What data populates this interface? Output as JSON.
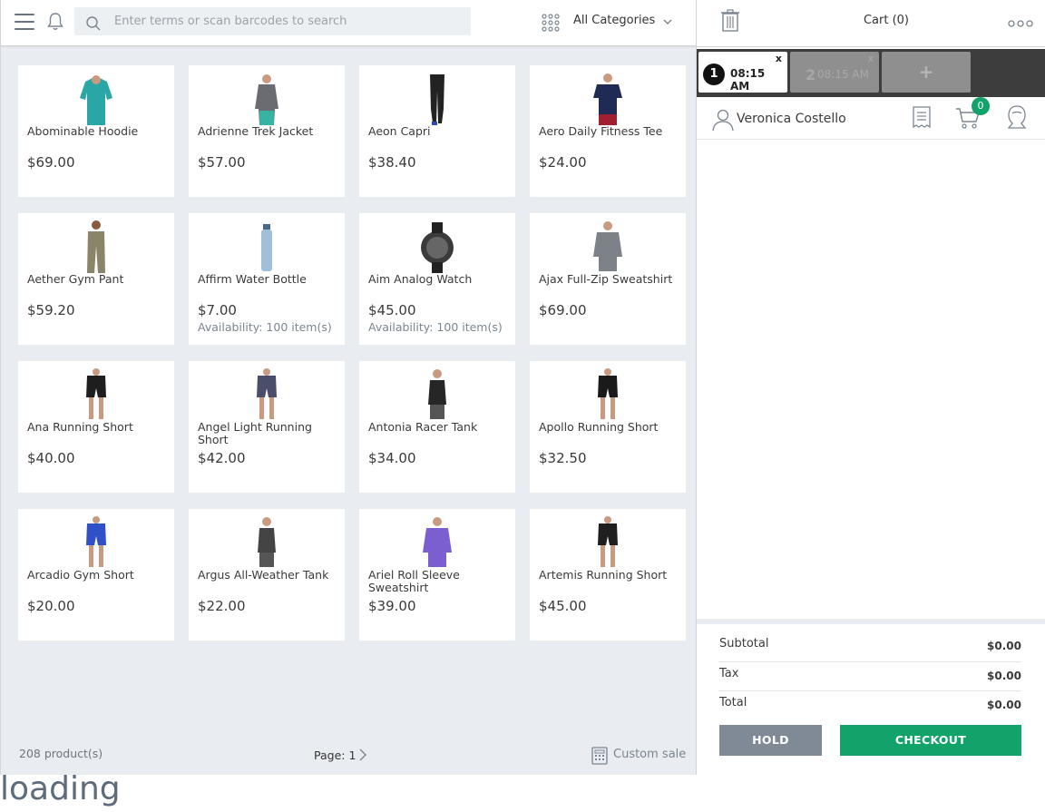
{
  "header": {
    "search_placeholder": "Enter terms or scan barcodes to search",
    "category": "All Categories"
  },
  "products": [
    {
      "name": "Abominable Hoodie",
      "price": "$69.00",
      "availability": "",
      "icon": "hoodie-thumbnail",
      "color": "#2aa6a6"
    },
    {
      "name": "Adrienne Trek Jacket",
      "price": "$57.00",
      "availability": "",
      "icon": "jacket-thumbnail",
      "color": "#6b6b72"
    },
    {
      "name": "Aeon Capri",
      "price": "$38.40",
      "availability": "",
      "icon": "capri-thumbnail",
      "color": "#222222"
    },
    {
      "name": "Aero Daily Fitness Tee",
      "price": "$24.00",
      "availability": "",
      "icon": "tee-thumbnail",
      "color": "#1f2a55"
    },
    {
      "name": "Aether Gym Pant",
      "price": "$59.20",
      "availability": "",
      "icon": "pant-thumbnail",
      "color": "#8a8468"
    },
    {
      "name": "Affirm Water Bottle",
      "price": "$7.00",
      "availability": "Availability: 100 item(s)",
      "icon": "bottle-thumbnail",
      "color": "#9fc0d8"
    },
    {
      "name": "Aim Analog Watch",
      "price": "$45.00",
      "availability": "Availability: 100 item(s)",
      "icon": "watch-thumbnail",
      "color": "#3b3b3b"
    },
    {
      "name": "Ajax Full-Zip Sweatshirt",
      "price": "$69.00",
      "availability": "",
      "icon": "sweatshirt-thumbnail",
      "color": "#7d8288"
    },
    {
      "name": "Ana Running Short",
      "price": "$40.00",
      "availability": "",
      "icon": "short-thumbnail",
      "color": "#1e1e1e"
    },
    {
      "name": "Angel Light Running Short",
      "price": "$42.00",
      "availability": "",
      "icon": "short-thumbnail",
      "color": "#4a4e6a"
    },
    {
      "name": "Antonia Racer Tank",
      "price": "$34.00",
      "availability": "",
      "icon": "tank-thumbnail",
      "color": "#262626"
    },
    {
      "name": "Apollo Running Short",
      "price": "$32.50",
      "availability": "",
      "icon": "short-thumbnail",
      "color": "#1a1a1a"
    },
    {
      "name": "Arcadio Gym Short",
      "price": "$20.00",
      "availability": "",
      "icon": "short-thumbnail",
      "color": "#3050c8"
    },
    {
      "name": "Argus All-Weather Tank",
      "price": "$22.00",
      "availability": "",
      "icon": "tank-thumbnail",
      "color": "#444444"
    },
    {
      "name": "Ariel Roll Sleeve Sweatshirt",
      "price": "$39.00",
      "availability": "",
      "icon": "sweatshirt-thumbnail",
      "color": "#7b5fd0"
    },
    {
      "name": "Artemis Running Short",
      "price": "$45.00",
      "availability": "",
      "icon": "short-thumbnail",
      "color": "#1f1f1f"
    }
  ],
  "footer": {
    "count": "208 product(s)",
    "page": "Page: 1",
    "custom_sale": "Custom sale"
  },
  "cart": {
    "title": "Cart (0)",
    "tabs": [
      {
        "number": "1",
        "time": "08:15 AM",
        "close": "x",
        "active": true
      },
      {
        "number": "2",
        "time": "08:15 AM",
        "close": "x",
        "active": false
      }
    ],
    "add_tab": "+",
    "customer": "Veronica Costello",
    "cart_count": "0",
    "totals": [
      {
        "label": "Subtotal",
        "value": "$0.00"
      },
      {
        "label": "Tax",
        "value": "$0.00"
      },
      {
        "label": "Total",
        "value": "$0.00"
      }
    ],
    "hold": "HOLD",
    "checkout": "CHECKOUT"
  },
  "colors": {
    "accent": "#12a36b",
    "hold": "#7f8a96",
    "tab_bar": "#3d3d3d",
    "background": "#e9edf1"
  },
  "status": "loading"
}
